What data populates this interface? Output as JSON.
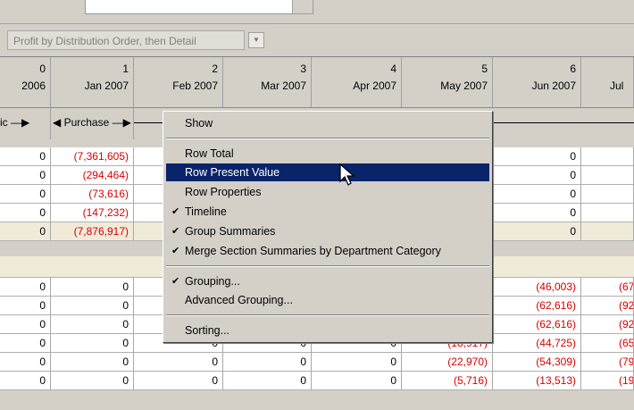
{
  "sort": {
    "value": "Profit by Distribution Order, then Detail"
  },
  "columns": [
    {
      "num": "0",
      "date": "2006"
    },
    {
      "num": "1",
      "date": "Jan 2007"
    },
    {
      "num": "2",
      "date": "Feb 2007"
    },
    {
      "num": "3",
      "date": "Mar 2007"
    },
    {
      "num": "4",
      "date": "Apr 2007"
    },
    {
      "num": "5",
      "date": "May 2007"
    },
    {
      "num": "6",
      "date": "Jun 2007"
    },
    {
      "num": "",
      "date": "Jul"
    }
  ],
  "timeline": {
    "label0": "ic —▶",
    "label1": "◀ Purchase —▶"
  },
  "rows_top": [
    [
      "0",
      "(7,361,605)",
      "",
      "",
      "",
      "",
      "0",
      ""
    ],
    [
      "0",
      "(294,464)",
      "",
      "",
      "",
      "",
      "0",
      ""
    ],
    [
      "0",
      "(73,616)",
      "",
      "",
      "",
      "",
      "0",
      ""
    ],
    [
      "0",
      "(147,232)",
      "",
      "",
      "",
      "",
      "0",
      ""
    ],
    [
      "0",
      "(7,876,917)",
      "",
      "",
      "",
      "",
      "0",
      ""
    ]
  ],
  "rows_bottom": [
    [
      "0",
      "0",
      "",
      "",
      "",
      "",
      "(46,003)",
      "(67"
    ],
    [
      "0",
      "0",
      "",
      "",
      "",
      "",
      "(62,616)",
      "(92"
    ],
    [
      "0",
      "0",
      "",
      "",
      "",
      "",
      "(62,616)",
      "(92"
    ],
    [
      "0",
      "0",
      "0",
      "0",
      "0",
      "(18,917)",
      "(44,725)",
      "(65"
    ],
    [
      "0",
      "0",
      "0",
      "0",
      "0",
      "(22,970)",
      "(54,309)",
      "(79"
    ],
    [
      "0",
      "0",
      "0",
      "0",
      "0",
      "(5,716)",
      "(13,513)",
      "(19"
    ]
  ],
  "menu": {
    "show": "Show",
    "row_total": "Row Total",
    "row_present_value": "Row Present Value",
    "row_properties": "Row Properties",
    "timeline": "Timeline",
    "group_summaries": "Group Summaries",
    "merge": "Merge Section Summaries by Department Category",
    "grouping": "Grouping...",
    "advanced_grouping": "Advanced Grouping...",
    "sorting": "Sorting...",
    "check": "✔"
  },
  "colors": {
    "negative": "#d60000",
    "highlight": "#0a246a",
    "summary_row": "#efebd8"
  }
}
